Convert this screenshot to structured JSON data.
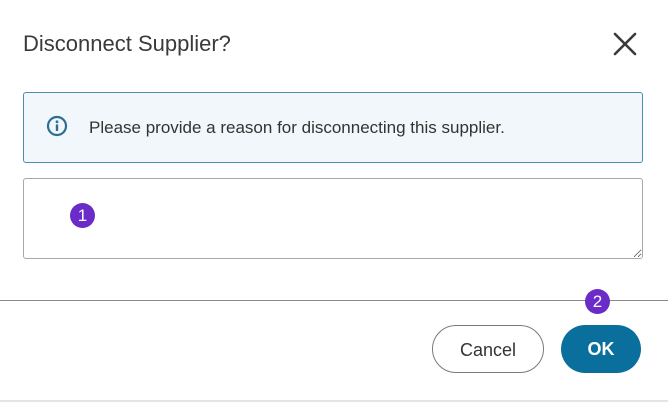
{
  "dialog": {
    "title": "Disconnect Supplier?",
    "close_icon": "close-icon",
    "info": {
      "icon": "info-icon",
      "message": "Please provide a reason for disconnecting this supplier."
    },
    "reason_input": {
      "value": "",
      "placeholder": ""
    },
    "markers": [
      "1",
      "2"
    ],
    "buttons": {
      "cancel_label": "Cancel",
      "ok_label": "OK"
    }
  },
  "colors": {
    "primary": "#0a6f9c",
    "info_border": "#4a8fb3",
    "info_background": "#f1f7fa",
    "marker": "#6a2bc8"
  }
}
